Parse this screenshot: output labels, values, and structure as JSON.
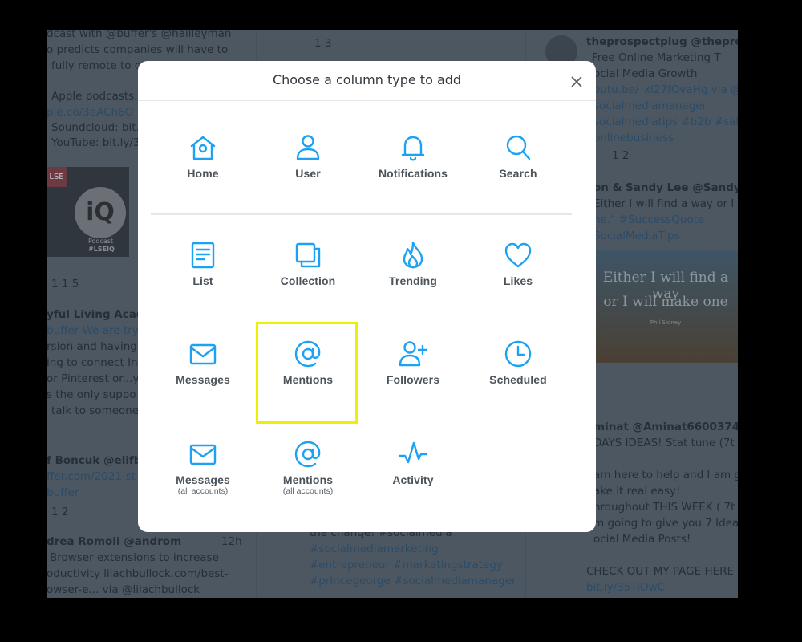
{
  "modal": {
    "title": "Choose a column type to add",
    "accent": "#1da1f2",
    "highlight_color": "#eef000",
    "highlighted_option": "Mentions",
    "options": [
      {
        "label": "Home",
        "icon": "home-icon"
      },
      {
        "label": "User",
        "icon": "user-icon"
      },
      {
        "label": "Notifications",
        "icon": "bell-icon"
      },
      {
        "label": "Search",
        "icon": "search-icon"
      },
      {
        "label": "List",
        "icon": "list-icon"
      },
      {
        "label": "Collection",
        "icon": "collection-icon"
      },
      {
        "label": "Trending",
        "icon": "flame-icon"
      },
      {
        "label": "Likes",
        "icon": "heart-icon"
      },
      {
        "label": "Messages",
        "icon": "envelope-icon"
      },
      {
        "label": "Mentions",
        "icon": "at-icon"
      },
      {
        "label": "Followers",
        "icon": "add-user-icon"
      },
      {
        "label": "Scheduled",
        "icon": "clock-icon"
      },
      {
        "label": "Messages",
        "sub": "(all accounts)",
        "icon": "envelope-icon"
      },
      {
        "label": "Mentions",
        "sub": "(all accounts)",
        "icon": "at-icon"
      },
      {
        "label": "Activity",
        "icon": "activity-icon"
      }
    ]
  },
  "background": {
    "col1": [
      "dcast with @buffer's @hailleyman",
      "o predicts companies will have to",
      "fully remote to compete",
      "Apple podcasts:",
      "ple.co/3eACh6O",
      "Soundcloud: bit.ly",
      "YouTube: bit.ly/3",
      "1  1  5",
      "yful Living Acad",
      "buffer We are try",
      "rsion and having",
      "ing to connect In",
      "or Pinterest or...y",
      "s the only suppo",
      "talk to someone",
      "f Boncuk @elifbo",
      "ffer.com/2021-st",
      "buffer",
      "1  2",
      "drea Romoli @androm",
      "Browser extensions to increase",
      "oductivity lilachbullock.com/best-",
      "owser-e... via @lilachbullock",
      "12h"
    ],
    "col1_media": {
      "logo": "LSE",
      "brand": "iQ",
      "caption1": "Podcast",
      "caption2": "#LSEIQ"
    },
    "col2": [
      "1  3",
      "the change! #socialmedia",
      "#socialmediamarketing",
      "#entrepreneur #marketingstrategy",
      "#princegeorge #socialmediamanager"
    ],
    "col3": [
      "theprospectplug @theprosp",
      "Free Online Marketing T",
      "ocial Media Growth",
      "outu.be/_xl27fOvaHg via @",
      "socialmediamanager",
      "socialmediatips #b2b #sal",
      "onlinebusiness",
      "1  2",
      "on & Sandy Lee @SandyLe",
      "Either I will find a way or I",
      "ne.\" #SuccessQuote",
      "SocialMediaTips",
      "minat @Aminat66003748",
      "DAYS IDEAS! Stat tune (7t",
      "am here to help and I am g",
      "ake it real easy!",
      "hroughout THIS WEEK ( 7t",
      "m going to give you 7 Idea",
      "ocial Media Posts!",
      "CHECK OUT MY PAGE HERE",
      "bit.ly/35TiOwC"
    ],
    "col3_media": {
      "line1": "Either I will find a way",
      "line2": "or I will make one",
      "credit": "Phil Sidney"
    }
  }
}
